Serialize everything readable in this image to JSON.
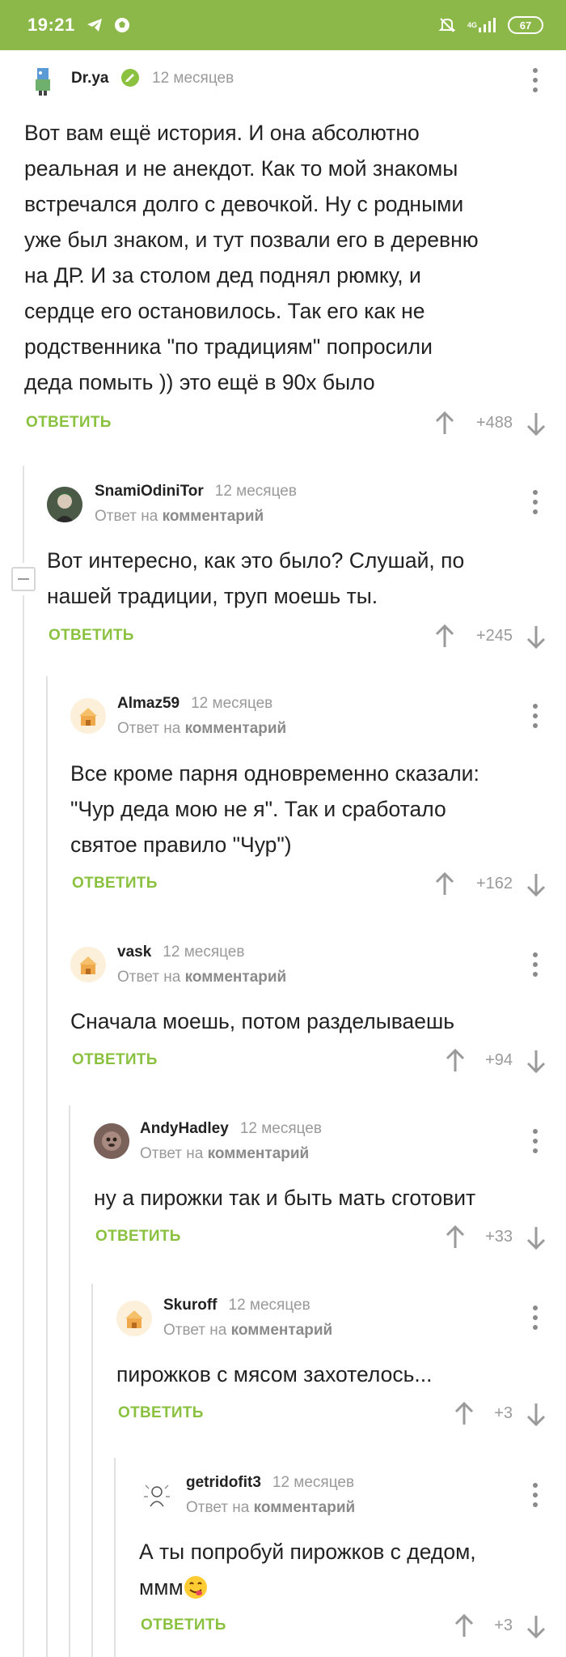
{
  "status": {
    "time": "19:21",
    "network": "4G",
    "battery": "67"
  },
  "ui": {
    "reply_prefix": "Ответ на",
    "reply_target": "комментарий",
    "answer_label": "ОТВЕТИТЬ"
  },
  "comments": [
    {
      "author": "Dr.ya",
      "time": "12 месяцев",
      "lines": [
        "Вот вам ещё история. И она абсолютно",
        "реальная и не анекдот. Как то мой знакомы",
        "встречался долго с девочкой. Ну с родными",
        "уже был знаком, и тут позвали его в деревню",
        "на ДР. И за столом дед поднял рюмку, и",
        "сердце его остановилось. Так его как не",
        "родственника \"по традициям\" попросили",
        "деда помыть )) это ещё в 90х было"
      ],
      "rating": "+488"
    },
    {
      "author": "SnamiOdiniTor",
      "time": "12 месяцев",
      "lines": [
        "Вот интересно, как это было? Слушай, по",
        "нашей традиции, труп моешь ты."
      ],
      "rating": "+245"
    },
    {
      "author": "Almaz59",
      "time": "12 месяцев",
      "lines": [
        "Все кроме парня одновременно сказали:",
        "\"Чур деда мою не я\". Так и сработало",
        "святое правило \"Чур\")"
      ],
      "rating": "+162"
    },
    {
      "author": "vask",
      "time": "12 месяцев",
      "lines": [
        "Сначала моешь, потом разделываешь"
      ],
      "rating": "+94"
    },
    {
      "author": "AndyHadley",
      "time": "12 месяцев",
      "lines": [
        "ну а пирожки так и быть мать сготовит"
      ],
      "rating": "+33"
    },
    {
      "author": "Skuroff",
      "time": "12 месяцев",
      "lines": [
        "пирожков с мясом захотелось..."
      ],
      "rating": "+3"
    },
    {
      "author": "getridofit3",
      "time": "12 месяцев",
      "lines": [
        "А ты попробуй пирожков с дедом,",
        "ммм"
      ],
      "emoji": "savoring-food-emoji",
      "rating": "+3"
    }
  ],
  "colors": {
    "status_bar": "#8cb84a",
    "answer_green": "#8ac13f",
    "muted_text": "#9a9a9a",
    "thread_line": "#e2e2e2"
  }
}
